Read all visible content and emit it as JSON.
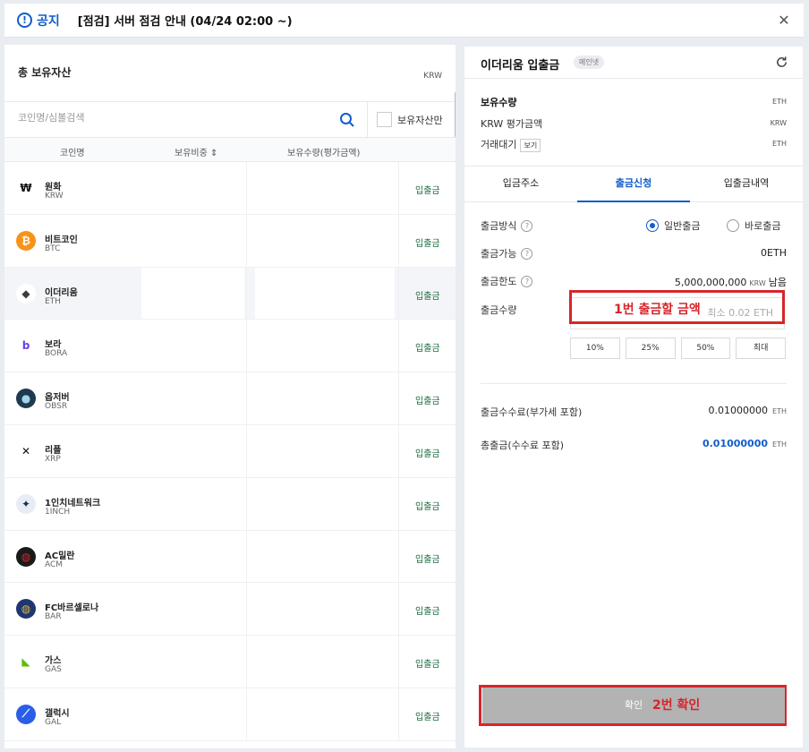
{
  "notice": {
    "icon_glyph": "!",
    "label": "공지",
    "text": "[점검] 서버 점검 안내 (04/24 02:00 ~)",
    "close_glyph": "✕"
  },
  "left": {
    "title": "총 보유자산",
    "currency": "KRW",
    "search_placeholder": "코인명/심볼검색",
    "holding_only_label": "보유자산만",
    "columns": {
      "name": "코인명",
      "ratio": "보유비중 ⇕",
      "amount": "보유수량(평가금액)"
    },
    "coins": [
      {
        "name": "원화",
        "symbol": "KRW",
        "icon": "won-icon",
        "glyph": "₩",
        "color": "#ffffff",
        "fg": "#111111",
        "action": "입출금",
        "active": false
      },
      {
        "name": "비트코인",
        "symbol": "BTC",
        "icon": "bitcoin-icon",
        "glyph": "₿",
        "color": "#f7931a",
        "fg": "#ffffff",
        "action": "입출금",
        "active": false
      },
      {
        "name": "이더리움",
        "symbol": "ETH",
        "icon": "ethereum-icon",
        "glyph": "◆",
        "color": "#ffffff",
        "fg": "#3c3c3d",
        "action": "입출금",
        "active": true
      },
      {
        "name": "보라",
        "symbol": "BORA",
        "icon": "bora-icon",
        "glyph": "b",
        "color": "#ffffff",
        "fg": "#6a3ee8",
        "action": "입출금",
        "active": false
      },
      {
        "name": "옵저버",
        "symbol": "OBSR",
        "icon": "observer-icon",
        "glyph": "●",
        "color": "#1e3a4f",
        "fg": "#9fd6e6",
        "action": "입출금",
        "active": false
      },
      {
        "name": "리플",
        "symbol": "XRP",
        "icon": "ripple-icon",
        "glyph": "✕",
        "color": "#ffffff",
        "fg": "#111111",
        "action": "입출금",
        "active": false
      },
      {
        "name": "1인치네트워크",
        "symbol": "1INCH",
        "icon": "1inch-icon",
        "glyph": "✦",
        "color": "#e8edf5",
        "fg": "#1b314f",
        "action": "입출금",
        "active": false
      },
      {
        "name": "AC밀란",
        "symbol": "ACM",
        "icon": "acmilan-icon",
        "glyph": "◍",
        "color": "#1a1a1a",
        "fg": "#d7252b",
        "action": "입출금",
        "active": false
      },
      {
        "name": "FC바르셀로나",
        "symbol": "BAR",
        "icon": "fcbarcelona-icon",
        "glyph": "◍",
        "color": "#1f3770",
        "fg": "#e0b53b",
        "action": "입출금",
        "active": false
      },
      {
        "name": "가스",
        "symbol": "GAS",
        "icon": "gas-icon",
        "glyph": "◣",
        "color": "#ffffff",
        "fg": "#58bf00",
        "action": "입출금",
        "active": false
      },
      {
        "name": "갤럭시",
        "symbol": "GAL",
        "icon": "galxe-icon",
        "glyph": "⟋",
        "color": "#2b5ee8",
        "fg": "#ffffff",
        "action": "입출금",
        "active": false
      }
    ]
  },
  "right": {
    "title": "이더리움 입출금",
    "badge": "메인넷",
    "summary": {
      "holding_label": "보유수량",
      "holding_unit": "ETH",
      "krw_label": "KRW 평가금액",
      "krw_unit": "KRW",
      "pending_label": "거래대기",
      "view_label": "보기",
      "pending_unit": "ETH"
    },
    "tabs": [
      {
        "label": "입금주소",
        "active": false
      },
      {
        "label": "출금신청",
        "active": true
      },
      {
        "label": "입출금내역",
        "active": false
      }
    ],
    "form": {
      "method_label": "출금방식",
      "method_options": [
        {
          "label": "일반출금",
          "selected": true
        },
        {
          "label": "바로출금",
          "selected": false
        }
      ],
      "available_label": "출금가능",
      "available_value": "0ETH",
      "limit_label": "출금한도",
      "limit_value": "5,000,000,000",
      "limit_unit": "KRW",
      "limit_suffix": "남음",
      "amount_label": "출금수량",
      "amount_placeholder": "최소 0.02 ETH",
      "percent_buttons": [
        "10%",
        "25%",
        "50%",
        "최대"
      ],
      "fee_label": "출금수수료(부가세 포함)",
      "fee_value": "0.01000000",
      "fee_unit": "ETH",
      "total_label": "총출금(수수료 포함)",
      "total_value": "0.01000000",
      "total_unit": "ETH",
      "confirm_label": "확인"
    },
    "annotations": {
      "amount_note": "1번 출금할 금액",
      "confirm_note": "2번 확인"
    },
    "colors": {
      "accent": "#115dcb",
      "annotation": "#d7252b",
      "action_text": "#1b6d3e"
    }
  }
}
